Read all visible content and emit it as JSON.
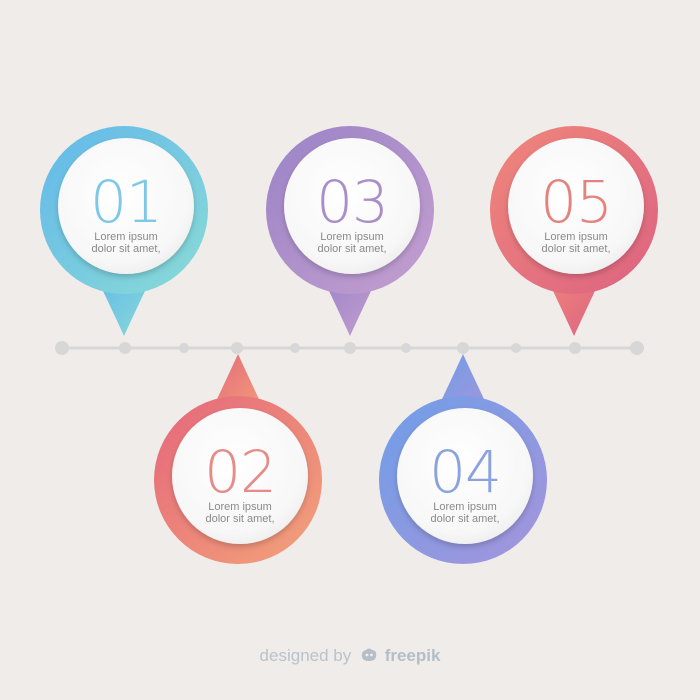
{
  "steps": [
    {
      "number": "01",
      "line1": "Lorem ipsum",
      "line2": "dolor sit amet,",
      "position": "top",
      "color": "#7fc7e6",
      "gradient": [
        "#62b8ea",
        "#8adbd6"
      ]
    },
    {
      "number": "02",
      "line1": "Lorem ipsum",
      "line2": "dolor sit amet,",
      "position": "bottom",
      "color": "#e68b88",
      "gradient": [
        "#e5677b",
        "#f3a37a"
      ]
    },
    {
      "number": "03",
      "line1": "Lorem ipsum",
      "line2": "dolor sit amet,",
      "position": "top",
      "color": "#a98ec7",
      "gradient": [
        "#9a83c6",
        "#c49fd0"
      ]
    },
    {
      "number": "04",
      "line1": "Lorem ipsum",
      "line2": "dolor sit amet,",
      "position": "bottom",
      "color": "#8aa3de",
      "gradient": [
        "#6f9ee8",
        "#a694db"
      ]
    },
    {
      "number": "05",
      "line1": "Lorem ipsum",
      "line2": "dolor sit amet,",
      "position": "top",
      "color": "#e4837e",
      "gradient": [
        "#f0867a",
        "#dc6382"
      ]
    }
  ],
  "footer": {
    "prefix": "designed by",
    "brand": "freepik"
  },
  "colors": {
    "background": "#efecea",
    "timeline": "#d7d7d7",
    "marker_inner": "#ffffff"
  }
}
